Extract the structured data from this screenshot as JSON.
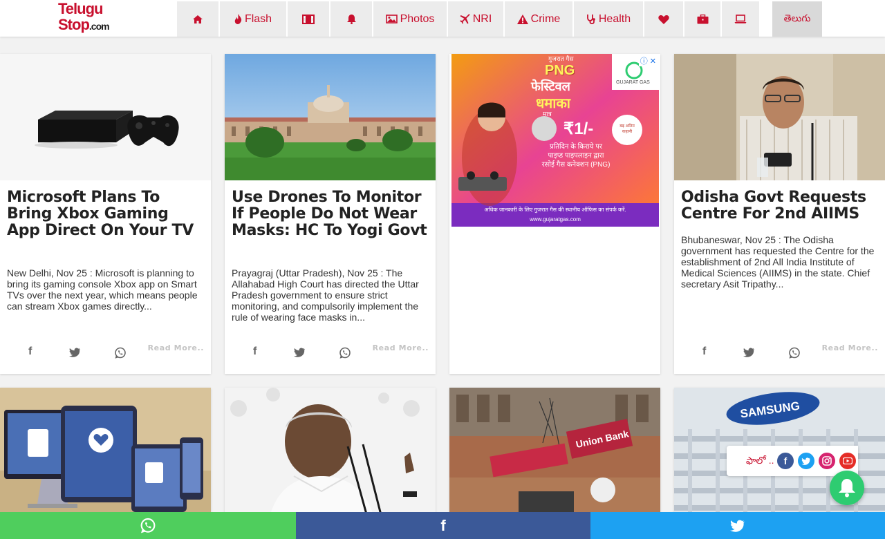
{
  "header": {
    "logo_line1": "Telugu",
    "logo_line2": "Stop",
    "logo_line3": ".com",
    "nav": [
      {
        "icon": "home-icon",
        "label": ""
      },
      {
        "icon": "fire-icon",
        "label": "Flash"
      },
      {
        "icon": "film-icon",
        "label": ""
      },
      {
        "icon": "bell-icon",
        "label": ""
      },
      {
        "icon": "image-icon",
        "label": "Photos"
      },
      {
        "icon": "plane-icon",
        "label": "NRI"
      },
      {
        "icon": "warning-icon",
        "label": "Crime"
      },
      {
        "icon": "stethoscope-icon",
        "label": "Health"
      },
      {
        "icon": "heart-icon",
        "label": ""
      },
      {
        "icon": "briefcase-icon",
        "label": ""
      },
      {
        "icon": "laptop-icon",
        "label": ""
      },
      {
        "icon": "",
        "label": "తెలుగు"
      }
    ]
  },
  "articles": [
    {
      "title": "Microsoft Plans To Bring Xbox Gaming App Direct On Your TV",
      "desc": "New Delhi, Nov 25 : Microsoft is planning to bring its gaming console Xbox app on Smart TVs over the next year, which means people can stream Xbox games directly...",
      "read_more": "Read More.."
    },
    {
      "title": "Use Drones To Monitor If People Do Not Wear Masks: HC To Yogi Govt",
      "desc": "Prayagraj (Uttar Pradesh), Nov 25 : The Allahabad High Court has directed the Uttar Pradesh government to ensure strict monitoring, and compulsorily implement the rule of wearing face masks in...",
      "read_more": "Read More.."
    },
    {
      "title": "Odisha Govt Requests Centre For 2nd AIIMS",
      "desc": "Bhubaneswar, Nov 25 : The Odisha government has requested the Centre for the establishment of 2nd All India Institute of Medical Sciences (AIIMS) in the state. Chief secretary Asit Tripathy...",
      "read_more": "Read More.."
    }
  ],
  "ad": {
    "tag": "गुजरात गैस",
    "headline": "PNG",
    "sub1": "फेस्टिवल",
    "sub2": "धमाका",
    "only": "मात्र",
    "price": "₹1/-",
    "price_desc": "प्रतिदिन के किराये पर पाइप्ड पाइपलाइन द्वारा रसोई गैस कनेक्शन (PNG)",
    "badge": "बढ़ अतिम कहानी",
    "brand": "GUJARAT GAS",
    "footer": "अधिक जानकारी के लिए गुजरात गैस की स्थानीय ऑफिस का संपर्क करें.",
    "url": "www.gujaratgas.com",
    "close": "ⓘ ✕"
  },
  "follow": {
    "label": "ఫాలో ..",
    "networks": [
      "facebook-icon",
      "twitter-icon",
      "instagram-icon",
      "youtube-icon"
    ]
  },
  "bottom_bar": {
    "whatsapp": "whatsapp-icon",
    "facebook": "f",
    "twitter": "twitter-icon"
  },
  "colors": {
    "accent": "#c8102e",
    "whatsapp": "#4fce5d",
    "facebook": "#3b5998",
    "twitter": "#1da1f2",
    "notify": "#2ecc71"
  }
}
